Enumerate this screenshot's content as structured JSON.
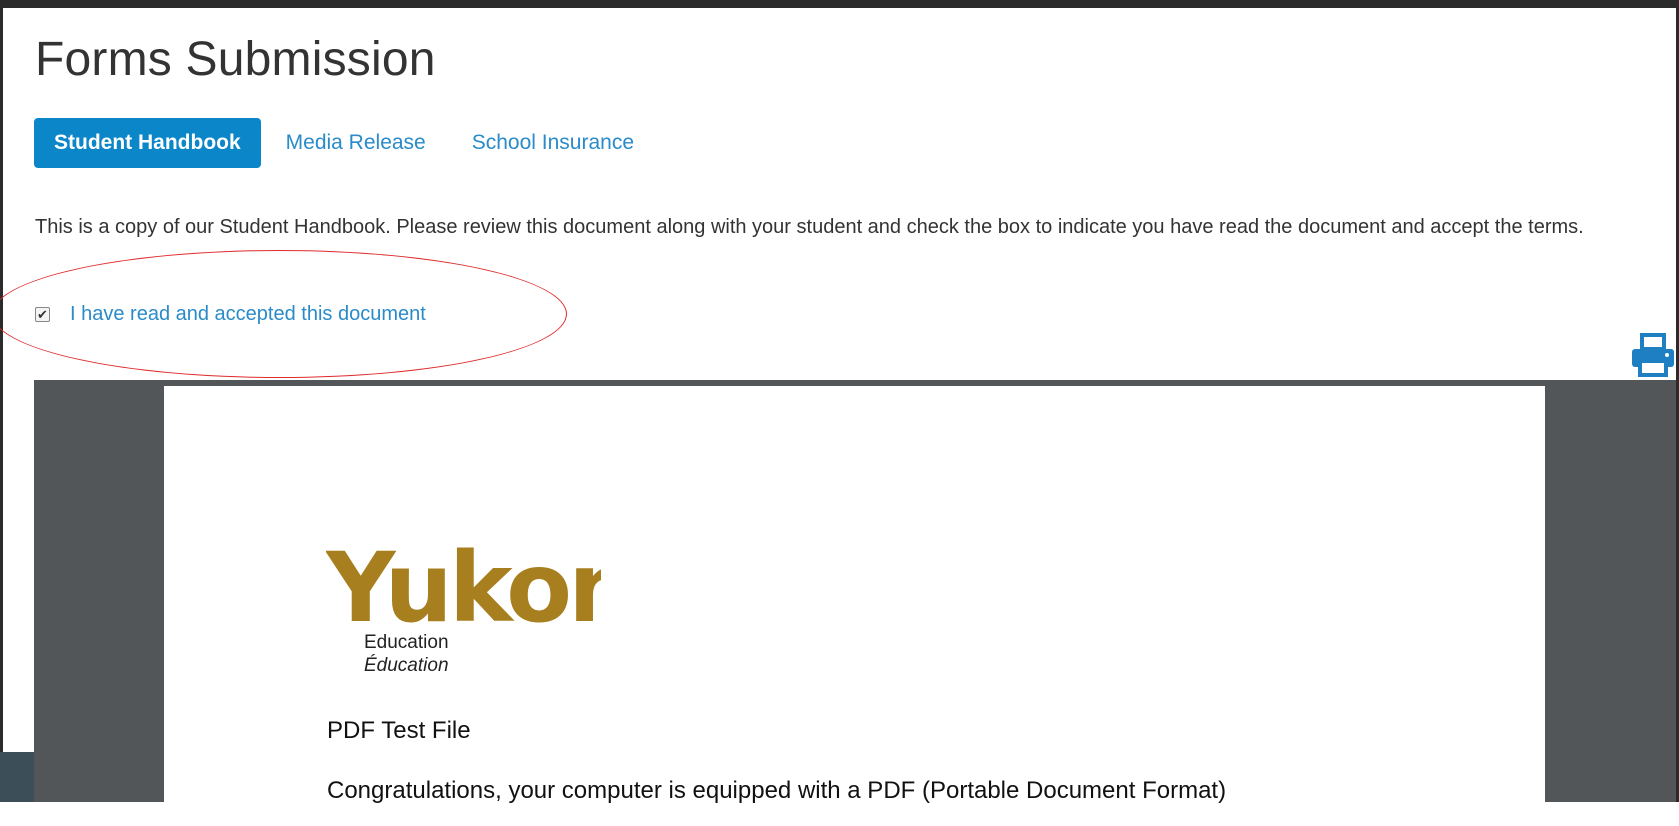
{
  "page": {
    "title": "Forms Submission"
  },
  "tabs": [
    {
      "label": "Student Handbook",
      "active": true
    },
    {
      "label": "Media Release",
      "active": false
    },
    {
      "label": "School Insurance",
      "active": false
    }
  ],
  "intro": {
    "text": "This is a copy of our Student Handbook. Please review this document along with your student and check the box to indicate you have read the document and accept the terms."
  },
  "acceptance": {
    "label": "I have read and accepted this document",
    "checked": true
  },
  "toolbar": {
    "print_icon": "print-icon"
  },
  "pdf": {
    "logo": {
      "word": "Yukon",
      "line1": "Education",
      "line2": "Éducation"
    },
    "heading": "PDF Test File",
    "body": "Congratulations, your computer is equipped with a PDF (Portable Document Format)"
  },
  "colors": {
    "accent": "#0b86c8",
    "link": "#2a8bc9",
    "viewer_bg": "#525659",
    "logo_gold": "#a77f1f",
    "annotation": "#e02a2a"
  }
}
